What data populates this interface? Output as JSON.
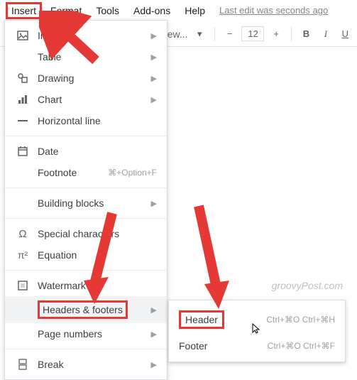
{
  "menubar": {
    "insert": "Insert",
    "format": "Format",
    "tools": "Tools",
    "addons": "Add-ons",
    "help": "Help",
    "last_edit": "Last edit was seconds ago"
  },
  "toolbar": {
    "font_fragment": "ew...",
    "minus": "−",
    "font_size": "12",
    "plus": "+",
    "bold": "B",
    "italic": "I",
    "underline": "U"
  },
  "menu": {
    "image": "Image",
    "table": "Table",
    "drawing": "Drawing",
    "chart": "Chart",
    "hr": "Horizontal line",
    "date": "Date",
    "footnote": "Footnote",
    "footnote_sc": "⌘+Option+F",
    "blocks": "Building blocks",
    "special": "Special characters",
    "equation": "Equation",
    "watermark": "Watermark",
    "hf": "Headers & footers",
    "pagenum": "Page numbers",
    "break": "Break"
  },
  "submenu": {
    "header": "Header",
    "header_sc": "Ctrl+⌘O Ctrl+⌘H",
    "footer": "Footer",
    "footer_sc": "Ctrl+⌘O Ctrl+⌘F"
  },
  "watermark": "groovyPost.com"
}
